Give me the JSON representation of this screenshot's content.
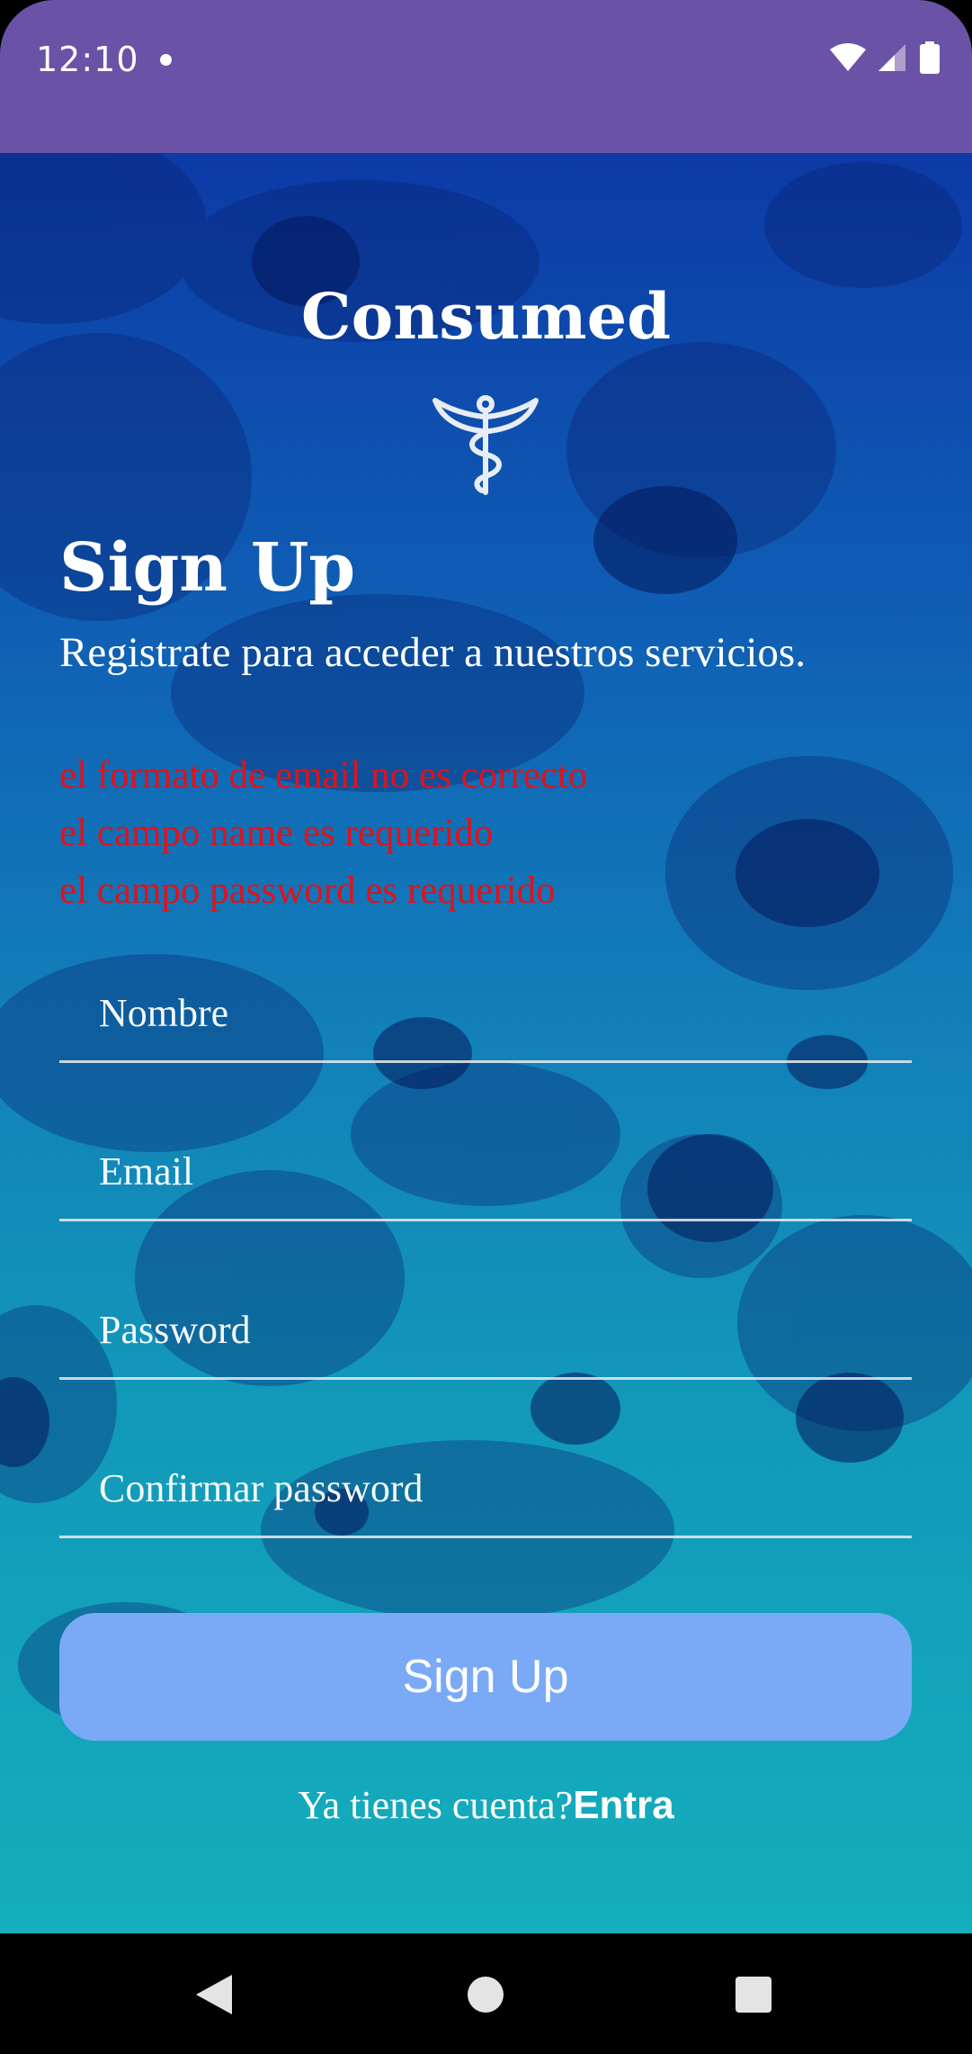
{
  "status_bar": {
    "time": "12:10",
    "icons": [
      "notification-dot-icon",
      "wifi-icon",
      "signal-icon",
      "battery-icon"
    ]
  },
  "app": {
    "title": "Consumed",
    "logo_icon": "caduceus-icon"
  },
  "form": {
    "heading": "Sign Up",
    "subheading": "Registrate para acceder a nuestros servicios.",
    "errors": [
      "el formato de email no es correcto",
      "el campo name es requerido",
      "el campo password es requerido"
    ],
    "fields": {
      "name": {
        "placeholder": "Nombre",
        "value": ""
      },
      "email": {
        "placeholder": "Email",
        "value": ""
      },
      "password": {
        "placeholder": "Password",
        "value": ""
      },
      "confirm_password": {
        "placeholder": "Confirmar password",
        "value": ""
      }
    },
    "submit_label": "Sign Up",
    "signin_prompt": "Ya tienes cuenta?",
    "signin_link": "Entra"
  },
  "nav_bar": {
    "icons": [
      "back-icon",
      "home-icon",
      "recents-icon"
    ]
  },
  "colors": {
    "status_bar": "#6a52a6",
    "error": "#e0121b",
    "button": "#7aaaf6",
    "gradient_top": "#0c3aa6",
    "gradient_bottom": "#14aebc"
  }
}
